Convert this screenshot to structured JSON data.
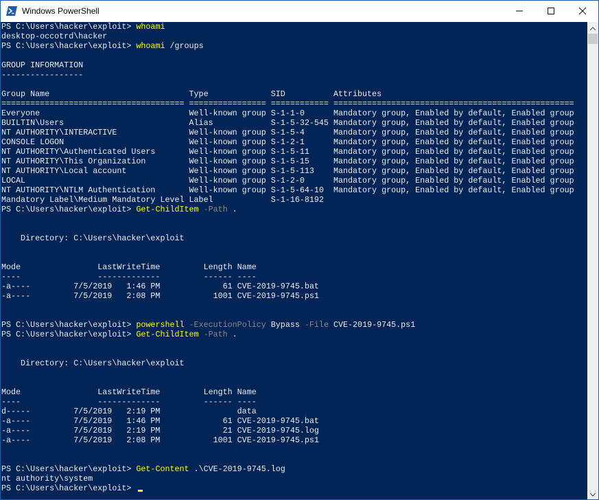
{
  "window": {
    "title": "Windows PowerShell"
  },
  "console": {
    "lines": [
      [
        {
          "t": "PS C:\\Users\\hacker\\exploit> ",
          "c": "prompt"
        },
        {
          "t": "whoami",
          "c": "cmd"
        }
      ],
      [
        {
          "t": "desktop-occotrd\\hacker",
          "c": "out"
        }
      ],
      [
        {
          "t": "PS C:\\Users\\hacker\\exploit> ",
          "c": "prompt"
        },
        {
          "t": "whoami",
          "c": "cmd"
        },
        {
          "t": " /groups",
          "c": "out"
        }
      ],
      [
        {
          "t": "",
          "c": "out"
        }
      ],
      [
        {
          "t": "GROUP INFORMATION",
          "c": "out"
        }
      ],
      [
        {
          "t": "-----------------",
          "c": "out"
        }
      ],
      [
        {
          "t": "",
          "c": "out"
        }
      ],
      [
        {
          "t": "Group Name                             Type             SID          Attributes",
          "c": "out"
        }
      ],
      [
        {
          "t": "====================================== ================ ============ ==================================================",
          "c": "out"
        }
      ],
      [
        {
          "t": "Everyone                               Well-known group S-1-1-0      Mandatory group, Enabled by default, Enabled group",
          "c": "out"
        }
      ],
      [
        {
          "t": "BUILTIN\\Users                          Alias            S-1-5-32-545 Mandatory group, Enabled by default, Enabled group",
          "c": "out"
        }
      ],
      [
        {
          "t": "NT AUTHORITY\\INTERACTIVE               Well-known group S-1-5-4      Mandatory group, Enabled by default, Enabled group",
          "c": "out"
        }
      ],
      [
        {
          "t": "CONSOLE LOGON                          Well-known group S-1-2-1      Mandatory group, Enabled by default, Enabled group",
          "c": "out"
        }
      ],
      [
        {
          "t": "NT AUTHORITY\\Authenticated Users       Well-known group S-1-5-11     Mandatory group, Enabled by default, Enabled group",
          "c": "out"
        }
      ],
      [
        {
          "t": "NT AUTHORITY\\This Organization         Well-known group S-1-5-15     Mandatory group, Enabled by default, Enabled group",
          "c": "out"
        }
      ],
      [
        {
          "t": "NT AUTHORITY\\Local account             Well-known group S-1-5-113    Mandatory group, Enabled by default, Enabled group",
          "c": "out"
        }
      ],
      [
        {
          "t": "LOCAL                                  Well-known group S-1-2-0      Mandatory group, Enabled by default, Enabled group",
          "c": "out"
        }
      ],
      [
        {
          "t": "NT AUTHORITY\\NTLM Authentication       Well-known group S-1-5-64-10  Mandatory group, Enabled by default, Enabled group",
          "c": "out"
        }
      ],
      [
        {
          "t": "Mandatory Label\\Medium Mandatory Level Label            S-1-16-8192",
          "c": "out"
        }
      ],
      [
        {
          "t": "PS C:\\Users\\hacker\\exploit> ",
          "c": "prompt"
        },
        {
          "t": "Get-ChildItem",
          "c": "cmd"
        },
        {
          "t": " -Path",
          "c": "param"
        },
        {
          "t": " .",
          "c": "out"
        }
      ],
      [
        {
          "t": "",
          "c": "out"
        }
      ],
      [
        {
          "t": "",
          "c": "out"
        }
      ],
      [
        {
          "t": "    Directory: C:\\Users\\hacker\\exploit",
          "c": "out"
        }
      ],
      [
        {
          "t": "",
          "c": "out"
        }
      ],
      [
        {
          "t": "",
          "c": "out"
        }
      ],
      [
        {
          "t": "Mode                LastWriteTime         Length Name",
          "c": "out"
        }
      ],
      [
        {
          "t": "----                -------------         ------ ----",
          "c": "out"
        }
      ],
      [
        {
          "t": "-a----         7/5/2019   1:46 PM             61 CVE-2019-9745.bat",
          "c": "out"
        }
      ],
      [
        {
          "t": "-a----         7/5/2019   2:08 PM           1001 CVE-2019-9745.ps1",
          "c": "out"
        }
      ],
      [
        {
          "t": "",
          "c": "out"
        }
      ],
      [
        {
          "t": "",
          "c": "out"
        }
      ],
      [
        {
          "t": "PS C:\\Users\\hacker\\exploit> ",
          "c": "prompt"
        },
        {
          "t": "powershell",
          "c": "cmd"
        },
        {
          "t": " -ExecutionPolicy",
          "c": "param"
        },
        {
          "t": " Bypass",
          "c": "out"
        },
        {
          "t": " -File",
          "c": "param"
        },
        {
          "t": " CVE-2019-9745.ps1",
          "c": "out"
        }
      ],
      [
        {
          "t": "PS C:\\Users\\hacker\\exploit> ",
          "c": "prompt"
        },
        {
          "t": "Get-ChildItem",
          "c": "cmd"
        },
        {
          "t": " -Path",
          "c": "param"
        },
        {
          "t": " .",
          "c": "out"
        }
      ],
      [
        {
          "t": "",
          "c": "out"
        }
      ],
      [
        {
          "t": "",
          "c": "out"
        }
      ],
      [
        {
          "t": "    Directory: C:\\Users\\hacker\\exploit",
          "c": "out"
        }
      ],
      [
        {
          "t": "",
          "c": "out"
        }
      ],
      [
        {
          "t": "",
          "c": "out"
        }
      ],
      [
        {
          "t": "Mode                LastWriteTime         Length Name",
          "c": "out"
        }
      ],
      [
        {
          "t": "----                -------------         ------ ----",
          "c": "out"
        }
      ],
      [
        {
          "t": "d-----         7/5/2019   2:19 PM                data",
          "c": "out"
        }
      ],
      [
        {
          "t": "-a----         7/5/2019   1:46 PM             61 CVE-2019-9745.bat",
          "c": "out"
        }
      ],
      [
        {
          "t": "-a----         7/5/2019   2:19 PM             21 CVE-2019-9745.log",
          "c": "out"
        }
      ],
      [
        {
          "t": "-a----         7/5/2019   2:08 PM           1001 CVE-2019-9745.ps1",
          "c": "out"
        }
      ],
      [
        {
          "t": "",
          "c": "out"
        }
      ],
      [
        {
          "t": "",
          "c": "out"
        }
      ],
      [
        {
          "t": "PS C:\\Users\\hacker\\exploit> ",
          "c": "prompt"
        },
        {
          "t": "Get-Content",
          "c": "cmd"
        },
        {
          "t": " .\\CVE-2019-9745.log",
          "c": "out"
        }
      ],
      [
        {
          "t": "nt authority\\system",
          "c": "out"
        }
      ],
      [
        {
          "t": "PS C:\\Users\\hacker\\exploit> ",
          "c": "prompt"
        },
        {
          "t": "",
          "c": "cursor"
        }
      ]
    ]
  },
  "colors": {
    "background": "#012456",
    "text": "#eeedf0",
    "command": "#ffff00",
    "parameter": "#8a8a8a"
  },
  "icons": [
    "powershell-icon",
    "minimize-icon",
    "maximize-icon",
    "close-icon",
    "scroll-up-icon",
    "scroll-down-icon"
  ]
}
